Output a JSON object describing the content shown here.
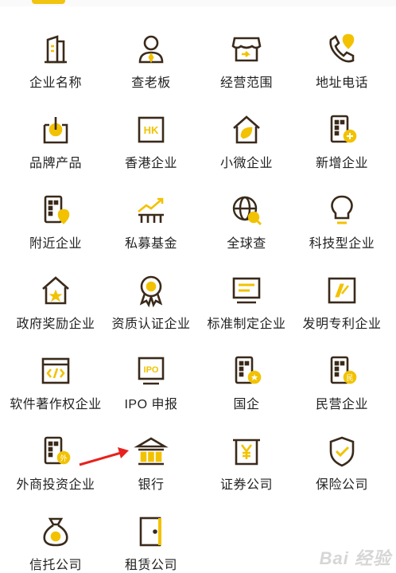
{
  "colors": {
    "stroke": "#3a2a1a",
    "accent": "#f2c200",
    "arrow": "#e8211d"
  },
  "tiles": [
    {
      "label": "企业名称",
      "icon": "building-doc-icon"
    },
    {
      "label": "查老板",
      "icon": "boss-person-icon"
    },
    {
      "label": "经营范围",
      "icon": "shop-awning-icon"
    },
    {
      "label": "地址电话",
      "icon": "phone-location-icon"
    },
    {
      "label": "品牌产品",
      "icon": "brand-box-icon"
    },
    {
      "label": "香港企业",
      "icon": "hk-badge-icon"
    },
    {
      "label": "小微企业",
      "icon": "house-leaf-icon"
    },
    {
      "label": "新增企业",
      "icon": "building-plus-icon"
    },
    {
      "label": "附近企业",
      "icon": "building-pin-icon"
    },
    {
      "label": "私募基金",
      "icon": "chart-trend-icon"
    },
    {
      "label": "全球查",
      "icon": "globe-search-icon"
    },
    {
      "label": "科技型企业",
      "icon": "lightbulb-icon"
    },
    {
      "label": "政府奖励企业",
      "icon": "house-star-icon"
    },
    {
      "label": "资质认证企业",
      "icon": "award-medal-icon"
    },
    {
      "label": "标准制定企业",
      "icon": "monitor-lines-icon"
    },
    {
      "label": "发明专利企业",
      "icon": "patent-certificate-icon"
    },
    {
      "label": "软件著作权企业",
      "icon": "code-window-icon"
    },
    {
      "label": "IPO 申报",
      "icon": "ipo-monitor-icon"
    },
    {
      "label": "国企",
      "icon": "building-star-icon"
    },
    {
      "label": "民营企业",
      "icon": "building-min-icon"
    },
    {
      "label": "外商投资企业",
      "icon": "building-wai-icon"
    },
    {
      "label": "银行",
      "icon": "bank-icon"
    },
    {
      "label": "证券公司",
      "icon": "yen-certificate-icon"
    },
    {
      "label": "保险公司",
      "icon": "shield-check-icon"
    },
    {
      "label": "信托公司",
      "icon": "money-bag-icon"
    },
    {
      "label": "租赁公司",
      "icon": "door-icon"
    }
  ],
  "watermark": "Bai 经验"
}
